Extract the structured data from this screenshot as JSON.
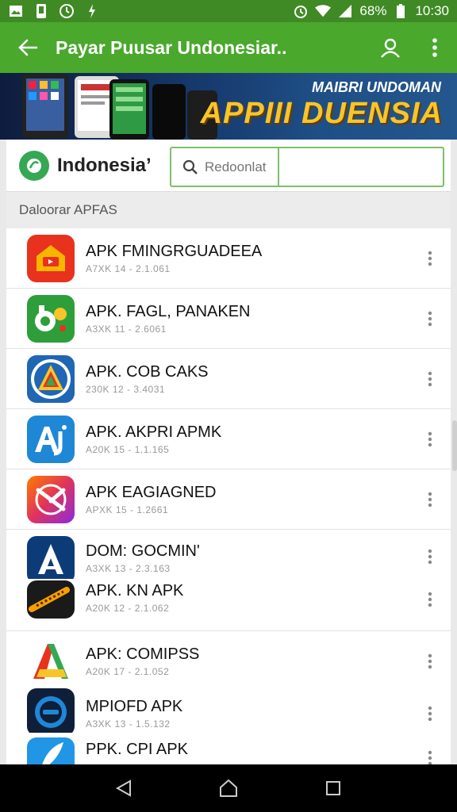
{
  "status_bar": {
    "battery": "68%",
    "time": "10:30",
    "left_icons": [
      "image-icon",
      "phone-icon",
      "clock-icon",
      "bolt-icon"
    ],
    "right_icons": [
      "alarm-icon",
      "wifi-icon",
      "signal-icon",
      "battery-icon"
    ]
  },
  "app_bar": {
    "title": "Payar Puusar Undonesiar..",
    "back_icon": "arrow-left-icon",
    "profile_icon": "person-icon",
    "menu_icon": "more-vert-icon"
  },
  "banner": {
    "subtitle": "MAIBRI UNDOMAN",
    "title": "APPIII DUENSIA"
  },
  "filter": {
    "country_label": "Indonesia’",
    "search_placeholder": "Redoonlat"
  },
  "section": {
    "title": "Daloorar APFAS"
  },
  "apps": [
    {
      "name": "APK FMINGRGUADEEA",
      "meta": "A7XK 14 - 2.1.061",
      "icon": "video-house-icon",
      "color": "#e8321e"
    },
    {
      "name": "APK. FAGL, PANAKEN",
      "meta": "A3XK 11 - 2.6061",
      "icon": "bp-logo-icon",
      "color": "#2e9e3a"
    },
    {
      "name": "APK. COB CAKS",
      "meta": "230K 12 - 3.4031",
      "icon": "triangle-logo-icon",
      "color": "#1f66b3"
    },
    {
      "name": "APK. AKPRI APMK",
      "meta": "A20K 15 - 1.1.165",
      "icon": "aj-logo-icon",
      "color": "#1e88d6"
    },
    {
      "name": "APK EAGIAGNED",
      "meta": "APXK 15 - 1.2661",
      "icon": "gradient-x-icon",
      "color": "#e0335c"
    },
    {
      "name": "DOM: GOCMIN'",
      "meta": "A3XK 13 - 2.3.163",
      "icon": "arrow-a-icon",
      "color": "#0d3b78"
    },
    {
      "name": "APK. KN APK",
      "meta": "A20K 12 - 2.1.062",
      "icon": "instrument-icon",
      "color": "#1a1a1a"
    },
    {
      "name": "APK: COMIPSS",
      "meta": "A20K 17 - 2.1.052",
      "icon": "color-a-icon",
      "color": "#ffffff"
    },
    {
      "name": "MPIOFD APK",
      "meta": "A3XK 13 - 1.5.132",
      "icon": "circle-logo-icon",
      "color": "#0f1f3a"
    },
    {
      "name": "PPK. CPI APK",
      "meta": "",
      "icon": "feather-icon",
      "color": "#2196e6"
    }
  ],
  "nav": {
    "back_icon": "nav-back-icon",
    "home_icon": "nav-home-icon",
    "recents_icon": "nav-recents-icon"
  }
}
